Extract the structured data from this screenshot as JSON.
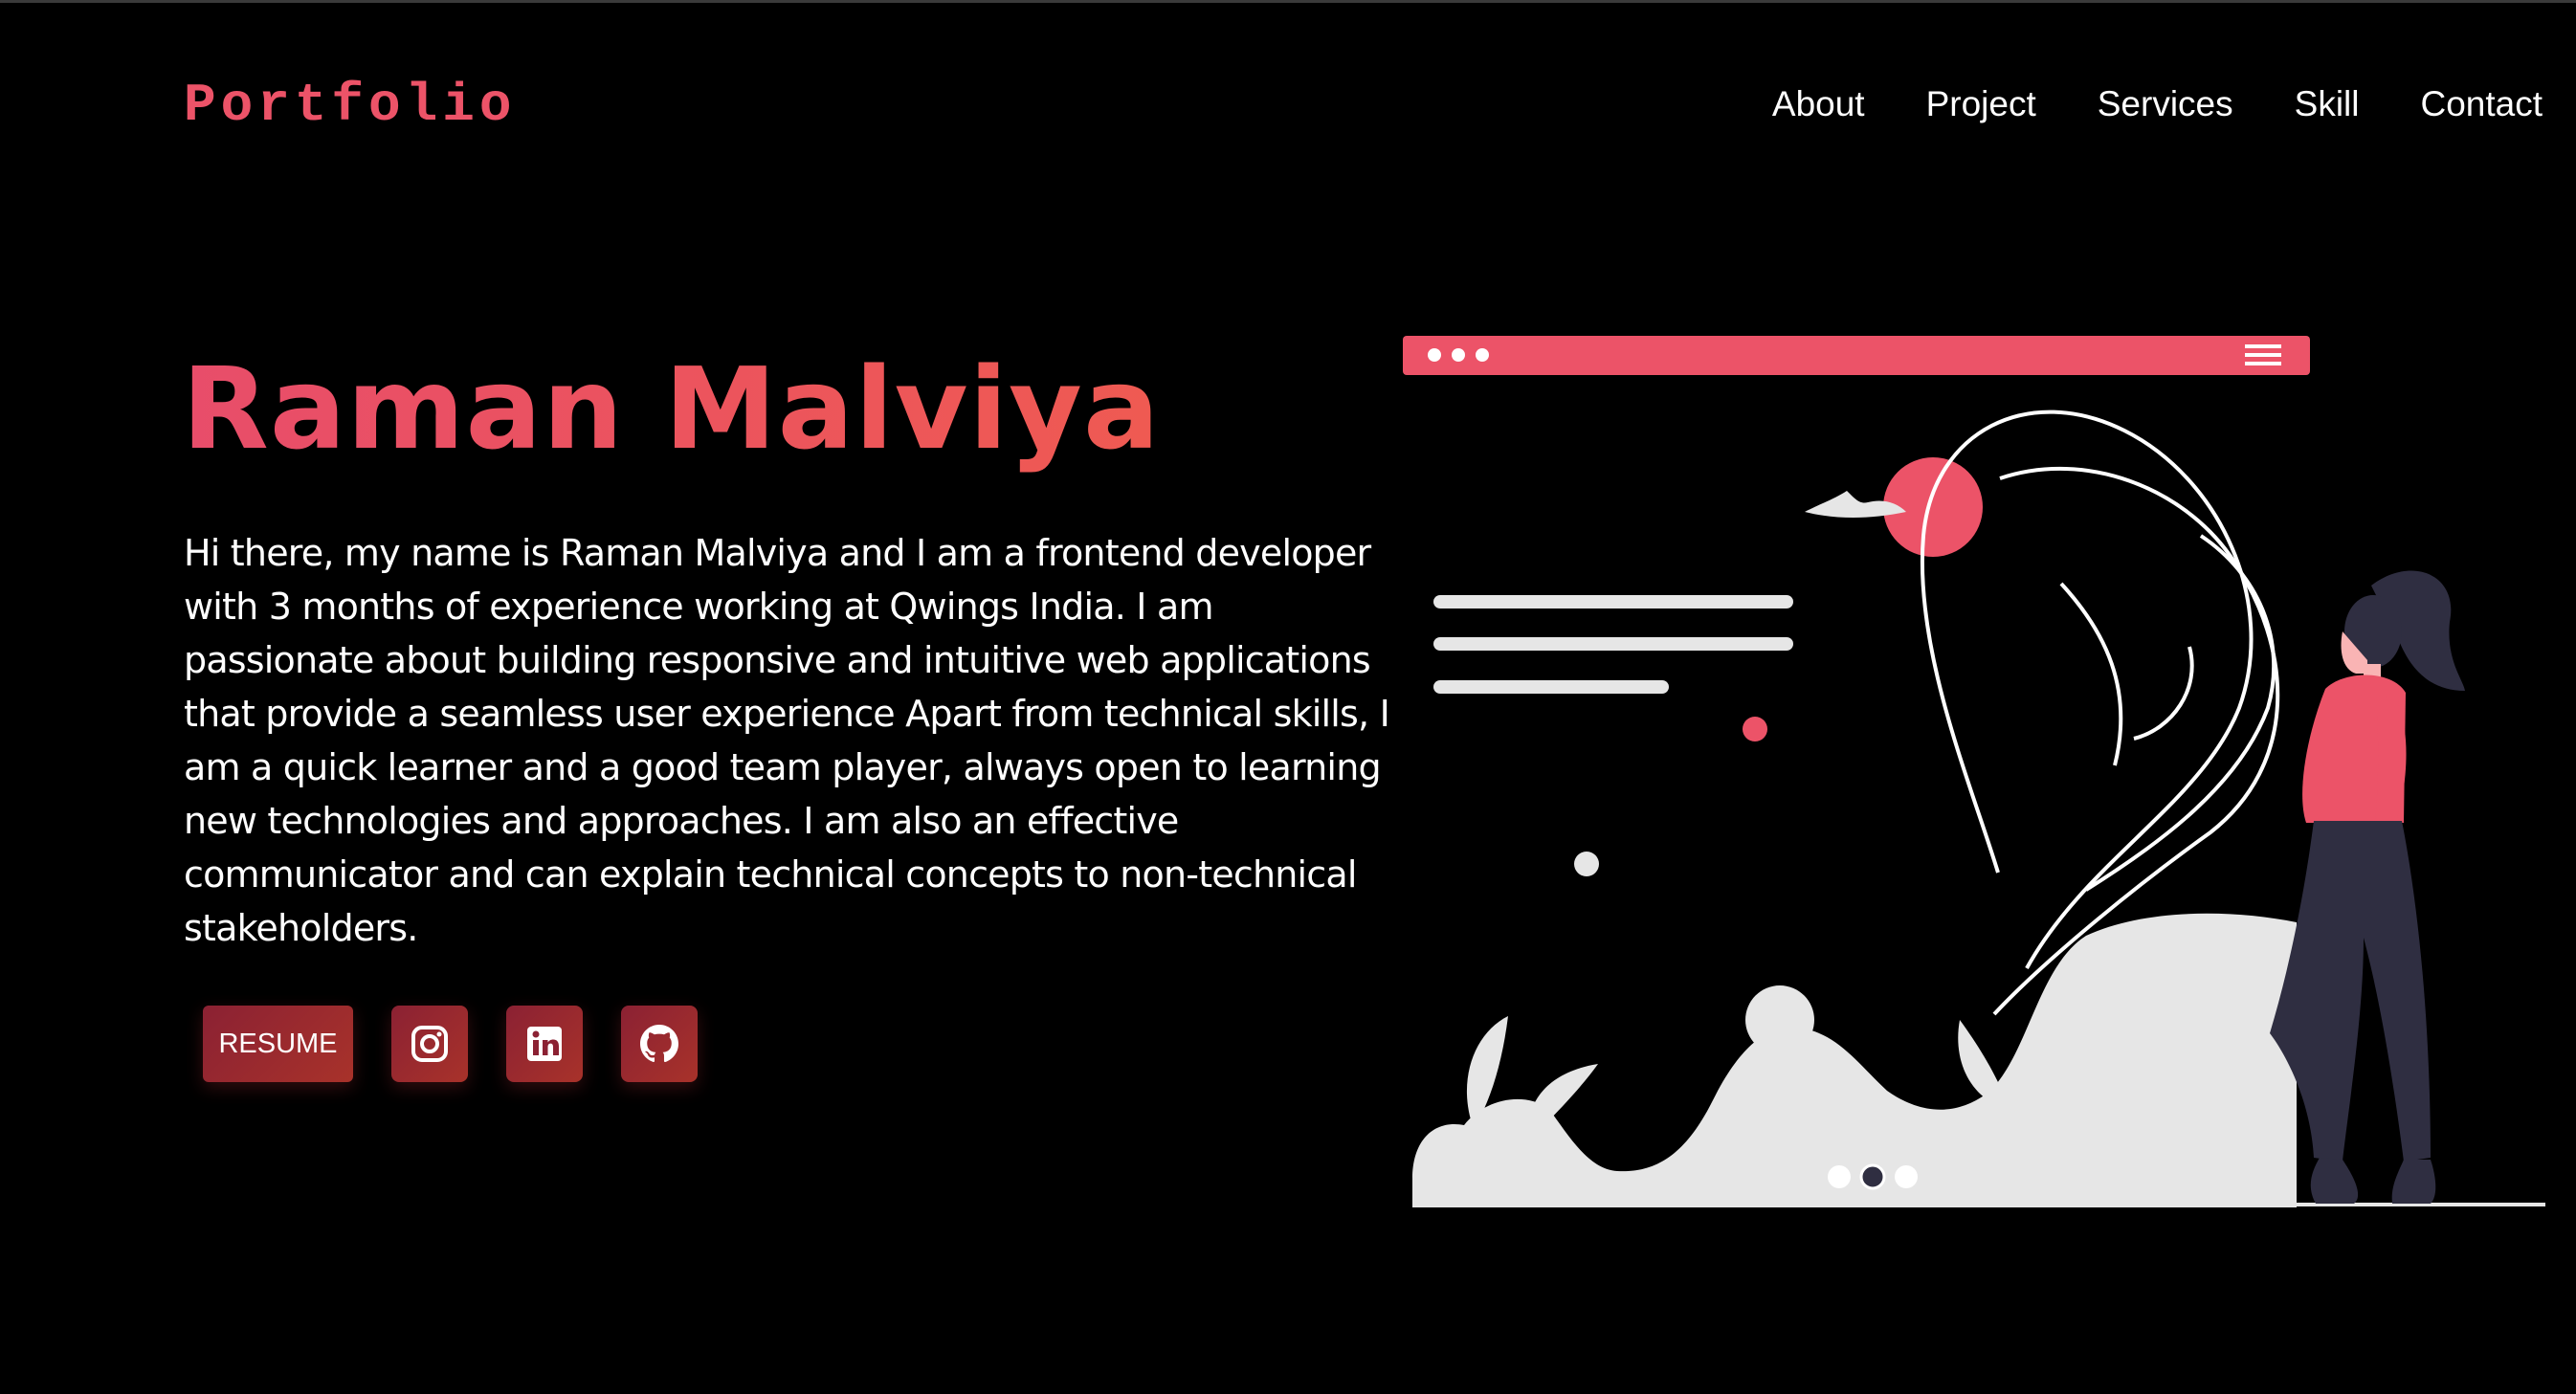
{
  "header": {
    "logo": "Portfolio",
    "nav": [
      "About",
      "Project",
      "Services",
      "Skill",
      "Contact"
    ]
  },
  "hero": {
    "name": "Raman Malviya",
    "bio": "Hi there, my name is Raman Malviya and I am a frontend developer with 3 months of experience working at Qwings India. I am passionate about building responsive and intuitive web applications that provide a seamless user experience Apart from technical skills, I am a quick learner and a good team player, always open to learning new technologies and approaches. I am also an effective communicator and can explain technical concepts to non-technical stakeholders.",
    "resume_label": "RESUME",
    "social_icons": [
      "instagram-icon",
      "linkedin-icon",
      "github-icon"
    ]
  },
  "colors": {
    "background": "#000000",
    "accent": "#ec5368",
    "button": "#8b2133",
    "text": "#ffffff",
    "illustration_light": "#e6e6e6",
    "illustration_dark": "#2f2e41"
  }
}
